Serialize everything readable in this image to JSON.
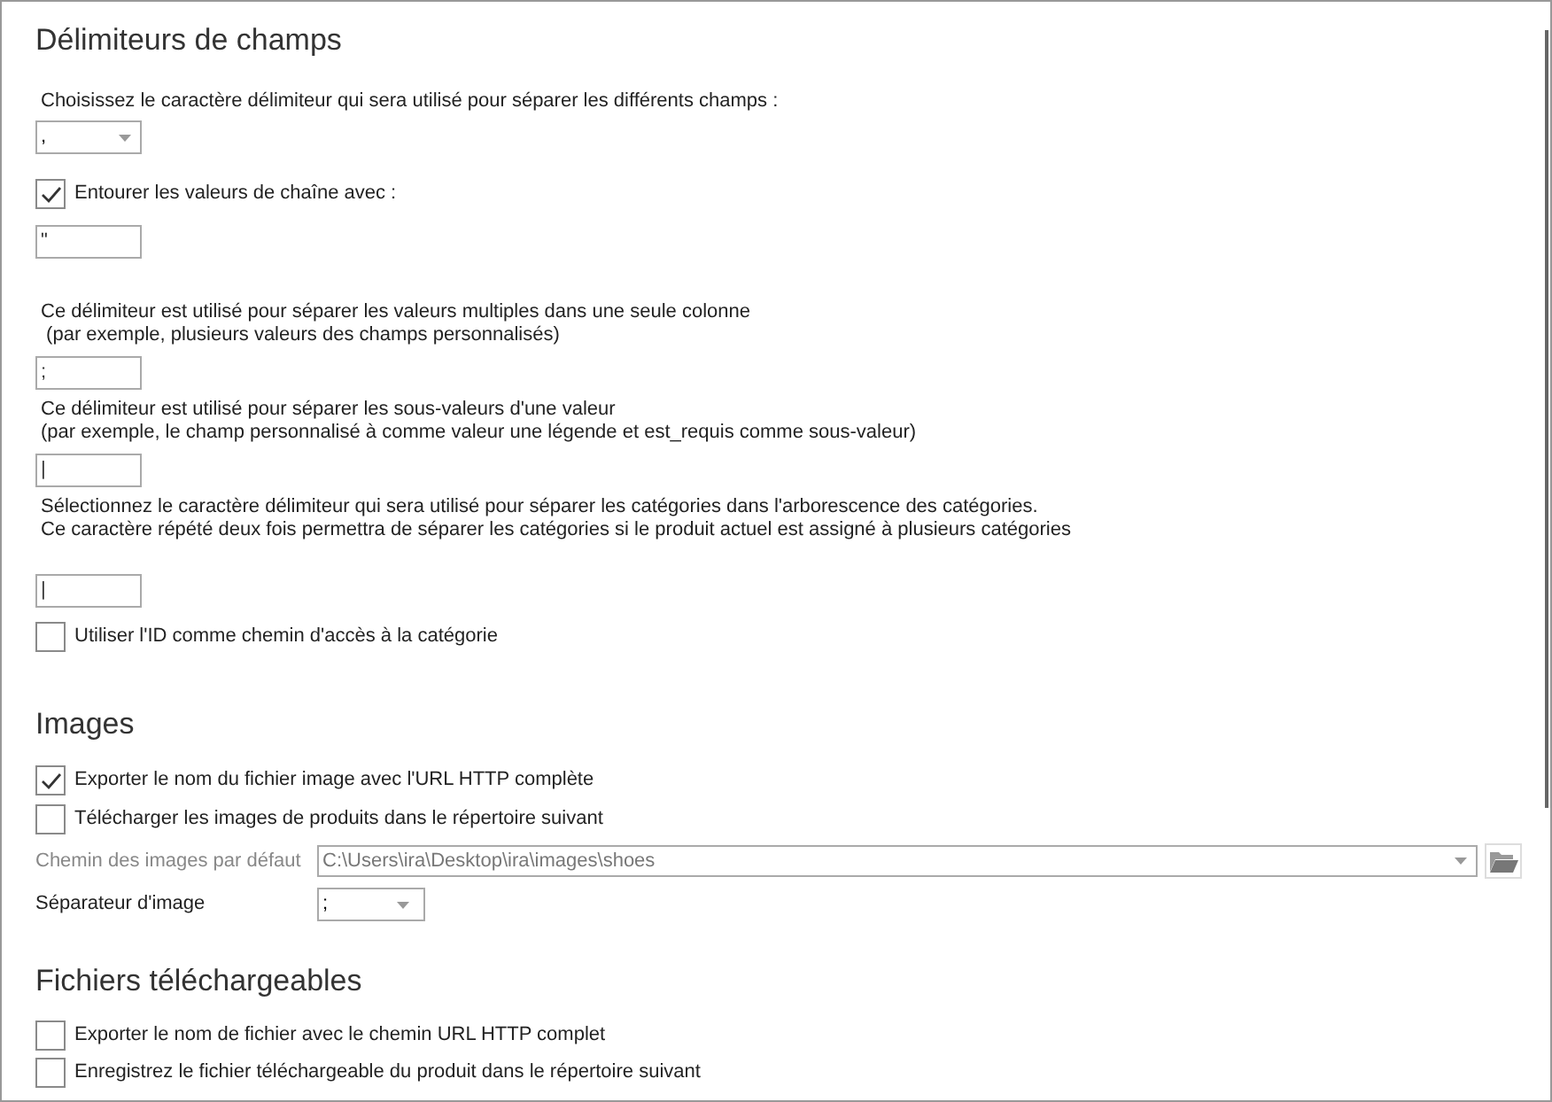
{
  "sections": [
    {
      "title": "Délimiteurs de champs",
      "items": [
        {
          "kind": "text",
          "lines": [
            "Choisissez le caractère délimiteur qui sera utilisé pour séparer les différents champs :"
          ]
        },
        {
          "kind": "combo",
          "value": ","
        },
        {
          "kind": "checkbox",
          "label": "Entourer les valeurs de chaîne avec :",
          "checked": true
        },
        {
          "kind": "input",
          "value": "\""
        },
        {
          "kind": "text",
          "lines": [
            "Ce délimiteur est utilisé pour séparer les valeurs multiples dans une seule colonne",
            " (par exemple, plusieurs valeurs des champs personnalisés)"
          ]
        },
        {
          "kind": "input",
          "value": ";"
        },
        {
          "kind": "text",
          "lines": [
            "Ce délimiteur est utilisé pour séparer les sous-valeurs d'une valeur",
            "(par exemple, le champ personnalisé à comme valeur une légende et est_requis comme sous-valeur)"
          ]
        },
        {
          "kind": "input",
          "value": "|"
        },
        {
          "kind": "text",
          "lines": [
            "Sélectionnez le caractère délimiteur qui sera utilisé pour séparer les catégories dans l'arborescence des catégories.",
            "Ce caractère répété deux fois permettra de séparer les catégories si le produit actuel est assigné à plusieurs catégories"
          ]
        },
        {
          "kind": "input",
          "value": "|"
        },
        {
          "kind": "checkbox",
          "label": "Utiliser l'ID comme chemin d'accès à la catégorie",
          "checked": false
        }
      ]
    },
    {
      "title": "Images",
      "items": [
        {
          "kind": "checkbox",
          "label": "Exporter le nom du fichier image avec l'URL HTTP complète",
          "checked": true
        },
        {
          "kind": "checkbox",
          "label": "Télécharger les images de produits dans le répertoire suivant",
          "checked": false
        },
        {
          "kind": "path",
          "label": "Chemin des images par défaut",
          "value": "C:\\Users\\ira\\Desktop\\ira\\images\\shoes",
          "disabled": true
        },
        {
          "kind": "combo_row",
          "label": "Séparateur d'image",
          "value": ";"
        }
      ]
    },
    {
      "title": "Fichiers téléchargeables",
      "items": [
        {
          "kind": "checkbox",
          "label": "Exporter le nom de fichier avec le chemin URL HTTP complet",
          "checked": false
        },
        {
          "kind": "checkbox",
          "label": "Enregistrez le fichier téléchargeable du produit dans le répertoire suivant",
          "checked": false
        }
      ]
    }
  ]
}
